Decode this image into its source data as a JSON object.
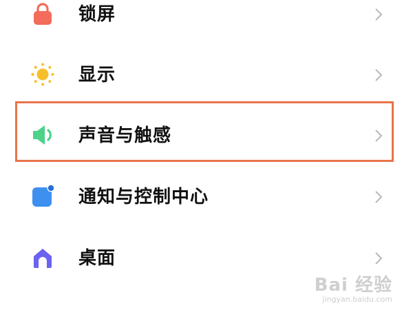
{
  "colors": {
    "lock_icon": "#f26b5b",
    "display_icon": "#f7bf2a",
    "sound_icon": "#4cd28a",
    "notify_icon": "#3d8ff0",
    "notify_dot": "#2b6fd6",
    "home_icon": "#6b63f0",
    "highlight_border": "#e8744a",
    "chevron": "#b8b8b8",
    "label_text": "#111111"
  },
  "settings": [
    {
      "label": "锁屏",
      "icon": "lock-icon"
    },
    {
      "label": "显示",
      "icon": "sun-icon"
    },
    {
      "label": "声音与触感",
      "icon": "speaker-icon",
      "highlighted": true
    },
    {
      "label": "通知与控制中心",
      "icon": "notification-icon"
    },
    {
      "label": "桌面",
      "icon": "home-icon"
    }
  ],
  "watermark": {
    "main": "Bai 经验",
    "sub": "jingyan.baidu.com"
  }
}
